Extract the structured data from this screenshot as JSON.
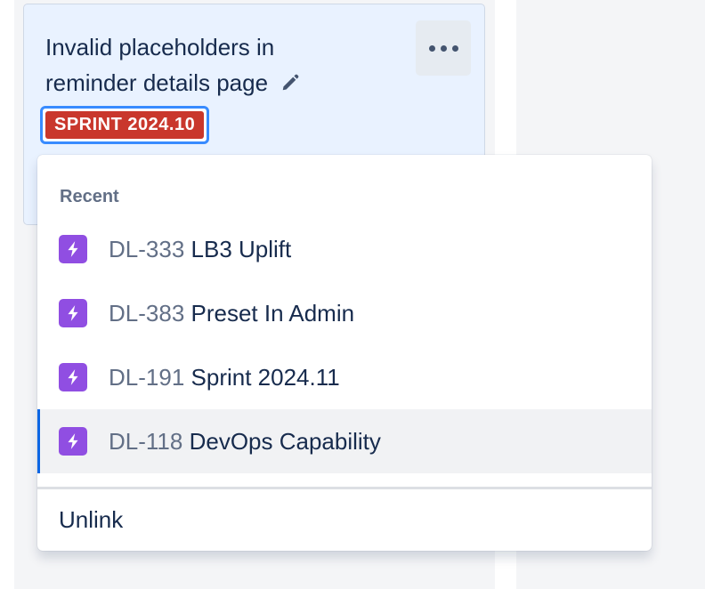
{
  "card": {
    "title": "Invalid placeholders in reminder details page",
    "sprint_badge": "SPRINT 2024.10",
    "more_icon": "more-horizontal-icon",
    "edit_icon": "pencil-icon"
  },
  "dropdown": {
    "section_heading": "Recent",
    "items": [
      {
        "key": "DL-333",
        "name": "LB3 Uplift",
        "icon": "epic-lightning-icon",
        "selected": false
      },
      {
        "key": "DL-383",
        "name": "Preset In Admin",
        "icon": "epic-lightning-icon",
        "selected": false
      },
      {
        "key": "DL-191",
        "name": "Sprint 2024.11",
        "icon": "epic-lightning-icon",
        "selected": false
      },
      {
        "key": "DL-118",
        "name": "DevOps Capability",
        "icon": "epic-lightning-icon",
        "selected": true
      }
    ],
    "unlink_label": "Unlink"
  },
  "colors": {
    "badge": "#c9372c",
    "epic_icon": "#904ee2",
    "focus_ring": "#388bff",
    "card_bg": "#e9f2ff",
    "selected_indicator": "#0c66e4"
  }
}
